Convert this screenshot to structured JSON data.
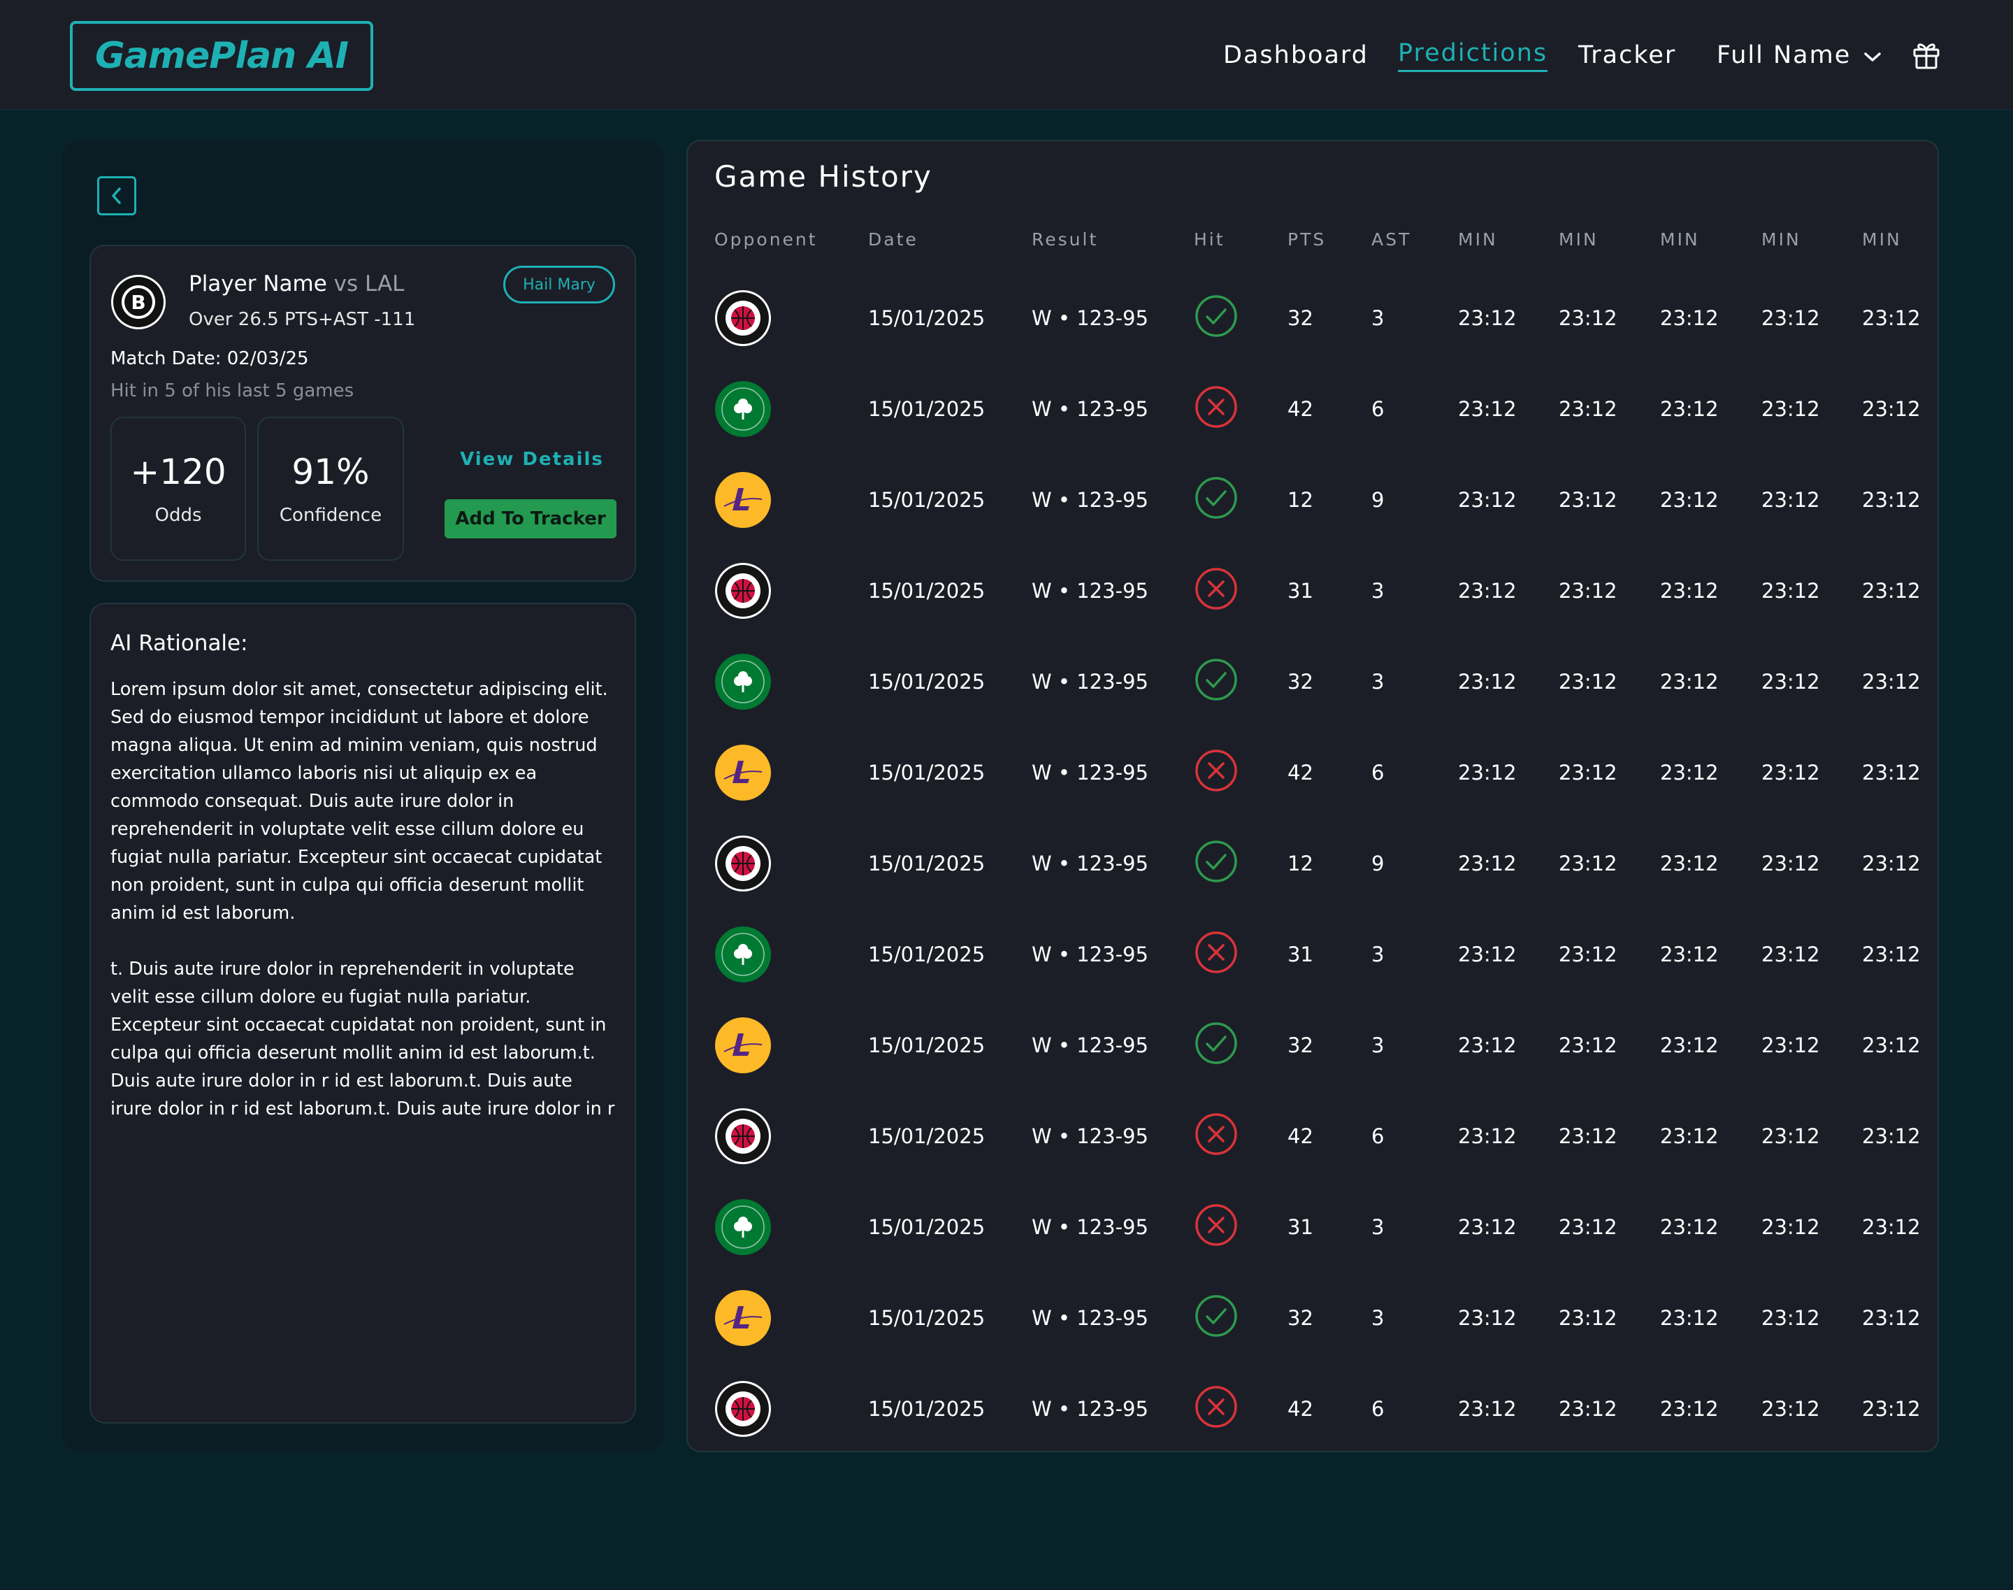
{
  "header": {
    "logo_text": "GamePlan AI",
    "nav": {
      "dashboard": "Dashboard",
      "predictions": "Predictions",
      "tracker": "Tracker",
      "user": "Full Name"
    },
    "active_nav": "Predictions",
    "accent_color": "#1eb1b4"
  },
  "pick": {
    "player_name": "Player Name",
    "opponent": "vs LAL",
    "bet_line": "Over 26.5 PTS+AST -111",
    "tag": "Hail Mary",
    "match_date": "Match Date: 02/03/25",
    "hit_rate": "Hit in 5 of his last 5 games",
    "odds_value": "+120",
    "odds_label": "Odds",
    "confidence_value": "91%",
    "confidence_label": "Confidence",
    "view_details": "View Details",
    "add_to_tracker": "Add To Tracker",
    "team_logo": "nets-logo"
  },
  "rationale": {
    "title": "AI Rationale:",
    "paragraph_1": "Lorem ipsum dolor sit amet, consectetur adipiscing elit. Sed do eiusmod tempor incididunt ut labore et dolore magna aliqua. Ut enim ad minim veniam, quis nostrud exercitation ullamco laboris nisi ut aliquip ex ea commodo consequat. Duis aute irure dolor in reprehenderit in voluptate velit esse cillum dolore eu fugiat nulla pariatur. Excepteur sint occaecat cupidatat non proident, sunt in culpa qui officia deserunt mollit anim id est laborum.",
    "paragraph_2": "t. Duis aute irure dolor in reprehenderit in voluptate velit esse cillum dolore eu fugiat nulla pariatur. Excepteur sint occaecat cupidatat non proident, sunt in culpa qui officia deserunt mollit anim id est laborum.t. Duis aute irure dolor in r  id est laborum.t. Duis aute irure dolor in r id est laborum.t. Duis aute irure dolor in r"
  },
  "game_history": {
    "title": "Game History",
    "columns": {
      "opponent": "Opponent",
      "date": "Date",
      "result": "Result",
      "hit": "Hit",
      "pts": "PTS",
      "ast": "AST",
      "min1": "MIN",
      "min2": "MIN",
      "min3": "MIN",
      "min4": "MIN",
      "min5": "MIN"
    },
    "colors": {
      "hit": "#2e9a4e",
      "miss": "#d9333a"
    },
    "rows": [
      {
        "team": "raptors",
        "date": "15/01/2025",
        "result": "W • 123-95",
        "hit": true,
        "pts": "32",
        "ast": "3",
        "min": [
          "23:12",
          "23:12",
          "23:12",
          "23:12",
          "23:12"
        ]
      },
      {
        "team": "celtics",
        "date": "15/01/2025",
        "result": "W • 123-95",
        "hit": false,
        "pts": "42",
        "ast": "6",
        "min": [
          "23:12",
          "23:12",
          "23:12",
          "23:12",
          "23:12"
        ]
      },
      {
        "team": "lakers",
        "date": "15/01/2025",
        "result": "W • 123-95",
        "hit": true,
        "pts": "12",
        "ast": "9",
        "min": [
          "23:12",
          "23:12",
          "23:12",
          "23:12",
          "23:12"
        ]
      },
      {
        "team": "raptors",
        "date": "15/01/2025",
        "result": "W • 123-95",
        "hit": false,
        "pts": "31",
        "ast": "3",
        "min": [
          "23:12",
          "23:12",
          "23:12",
          "23:12",
          "23:12"
        ]
      },
      {
        "team": "celtics",
        "date": "15/01/2025",
        "result": "W • 123-95",
        "hit": true,
        "pts": "32",
        "ast": "3",
        "min": [
          "23:12",
          "23:12",
          "23:12",
          "23:12",
          "23:12"
        ]
      },
      {
        "team": "lakers",
        "date": "15/01/2025",
        "result": "W • 123-95",
        "hit": false,
        "pts": "42",
        "ast": "6",
        "min": [
          "23:12",
          "23:12",
          "23:12",
          "23:12",
          "23:12"
        ]
      },
      {
        "team": "raptors",
        "date": "15/01/2025",
        "result": "W • 123-95",
        "hit": true,
        "pts": "12",
        "ast": "9",
        "min": [
          "23:12",
          "23:12",
          "23:12",
          "23:12",
          "23:12"
        ]
      },
      {
        "team": "celtics",
        "date": "15/01/2025",
        "result": "W • 123-95",
        "hit": false,
        "pts": "31",
        "ast": "3",
        "min": [
          "23:12",
          "23:12",
          "23:12",
          "23:12",
          "23:12"
        ]
      },
      {
        "team": "lakers",
        "date": "15/01/2025",
        "result": "W • 123-95",
        "hit": true,
        "pts": "32",
        "ast": "3",
        "min": [
          "23:12",
          "23:12",
          "23:12",
          "23:12",
          "23:12"
        ]
      },
      {
        "team": "raptors",
        "date": "15/01/2025",
        "result": "W • 123-95",
        "hit": false,
        "pts": "42",
        "ast": "6",
        "min": [
          "23:12",
          "23:12",
          "23:12",
          "23:12",
          "23:12"
        ]
      },
      {
        "team": "celtics",
        "date": "15/01/2025",
        "result": "W • 123-95",
        "hit": false,
        "pts": "31",
        "ast": "3",
        "min": [
          "23:12",
          "23:12",
          "23:12",
          "23:12",
          "23:12"
        ]
      },
      {
        "team": "lakers",
        "date": "15/01/2025",
        "result": "W • 123-95",
        "hit": true,
        "pts": "32",
        "ast": "3",
        "min": [
          "23:12",
          "23:12",
          "23:12",
          "23:12",
          "23:12"
        ]
      },
      {
        "team": "raptors",
        "date": "15/01/2025",
        "result": "W • 123-95",
        "hit": false,
        "pts": "42",
        "ast": "6",
        "min": [
          "23:12",
          "23:12",
          "23:12",
          "23:12",
          "23:12"
        ]
      }
    ]
  }
}
